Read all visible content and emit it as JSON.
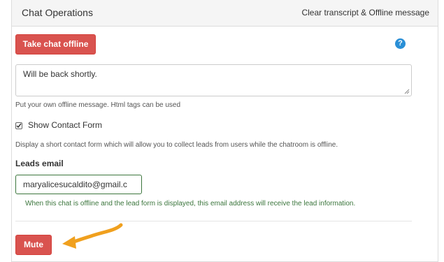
{
  "panel": {
    "title": "Chat Operations",
    "heading_link": "Clear transcript & Offline message"
  },
  "offline": {
    "button_label": "Take chat offline",
    "help_icon_label": "?",
    "message_value": "Will be back shortly.",
    "message_help": "Put your own offline message. Html tags can be used"
  },
  "contact_form": {
    "checked": true,
    "label": "Show Contact Form",
    "help": "Display a short contact form which will allow you to collect leads from users while the chatroom is offline."
  },
  "leads": {
    "label": "Leads email",
    "email_value": "maryalicesucaldito@gmail.c",
    "help": "When this chat is offline and the lead form is displayed, this email address will receive the lead information."
  },
  "mute": {
    "button_label": "Mute"
  },
  "colors": {
    "danger": "#d9534f",
    "success_text": "#3c763d",
    "info_icon": "#2a8fd6",
    "annotation_arrow": "#f0a01e"
  },
  "icons": [
    "question-circle-icon",
    "checkmark-icon",
    "resize-grip-icon",
    "annotation-arrow-icon"
  ]
}
